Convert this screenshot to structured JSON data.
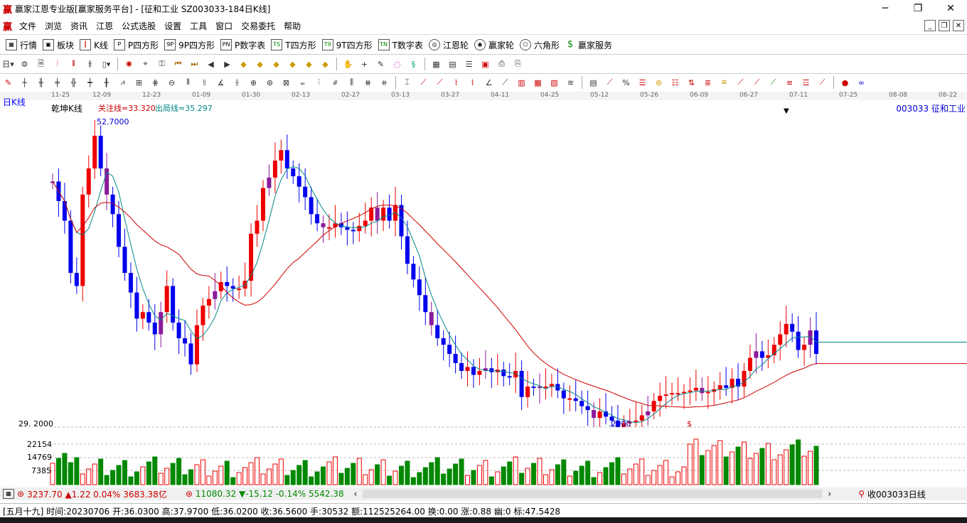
{
  "window": {
    "title": "赢家江恩专业版[赢家服务平台] - [征和工业  SZ003033-184日K线]",
    "app_icon": "赢"
  },
  "menu": [
    "文件",
    "浏览",
    "资讯",
    "江恩",
    "公式选股",
    "设置",
    "工具",
    "窗口",
    "交易委托",
    "帮助"
  ],
  "toolbar_main": [
    "行情",
    "板块",
    "K线",
    "P四方形",
    "9P四方形",
    "P数字表",
    "T四方形",
    "9T四方形",
    "T数字表",
    "江恩轮",
    "赢家轮",
    "六角形",
    "赢家服务"
  ],
  "toolbar_main_icons": [
    "grid-icon",
    "blocks-icon",
    "kline-icon",
    "P",
    "9P",
    "PN",
    "TS",
    "T9",
    "TN",
    "gann-wheel-icon",
    "winner-wheel-icon",
    "hexagon-icon",
    "dollar-icon"
  ],
  "chart": {
    "period_label": "日K线",
    "indicator_name": "乾坤K线",
    "focus_line": "关注线=33.320",
    "exit_line": "出局线=35.297",
    "stock_label": "003033  征和工业",
    "high_label": "52.7000",
    "low_label": "29.2000",
    "low_marker": ".2000",
    "dollar_marker": "$",
    "dates": [
      "11-25",
      "12-09",
      "12-23",
      "01-09",
      "01-30",
      "02-13",
      "02-27",
      "03-13",
      "03-27",
      "04-11",
      "04-25",
      "05-12",
      "05-26",
      "06-09",
      "06-27",
      "07-11",
      "07-25",
      "08-08",
      "08-22"
    ],
    "vol_ticks": [
      "22154",
      "14769",
      "7385"
    ],
    "price_tick": "29. 2000"
  },
  "chart_data": {
    "type": "candlestick",
    "title": "乾坤K线",
    "price_range": [
      29.2,
      52.7
    ],
    "closes": [
      48,
      46.5,
      45,
      41,
      40,
      47,
      49,
      51.5,
      49,
      47,
      45.5,
      43,
      41,
      39.5,
      37.5,
      38,
      37.2,
      36.3,
      38,
      40,
      37.2,
      36,
      35.6,
      34,
      37,
      38.5,
      39,
      39.6,
      40.3,
      40,
      39.8,
      39.8,
      40.4,
      44,
      45,
      47.5,
      48.3,
      49.6,
      50.4,
      49,
      48.4,
      47.6,
      46.8,
      45.5,
      44.8,
      44.5,
      44.5,
      44.8,
      44.5,
      44.3,
      44.2,
      44.6,
      45,
      46,
      45,
      46,
      45,
      46.2,
      43.8,
      41.7,
      40.5,
      39.3,
      38,
      37,
      36,
      35.5,
      34.8,
      34.1,
      33.5,
      33.8,
      33.2,
      33.5,
      33.7,
      33.4,
      33.6,
      33.1,
      33,
      33.5,
      31.5,
      32.3,
      32.2,
      32.3,
      32.3,
      32.5,
      32,
      31.4,
      31.4,
      31.2,
      30.8,
      30.5,
      29.9,
      30.4,
      30,
      29.7,
      29.2,
      29.5,
      29.6,
      29.7,
      30.1,
      30.4,
      31.2,
      31.6,
      31.7,
      31.8,
      31.8,
      31.9,
      32,
      32.2,
      31.8,
      31.9,
      32.1,
      32.4,
      32.2,
      32.9,
      32.3,
      33.5,
      34.5,
      35,
      34.5,
      34.7,
      35.5,
      36.3,
      37.1,
      36.5,
      35.1,
      35.5,
      36.6,
      34.8
    ],
    "volume_ticks": [
      22154,
      14769,
      7385
    ]
  }
}
